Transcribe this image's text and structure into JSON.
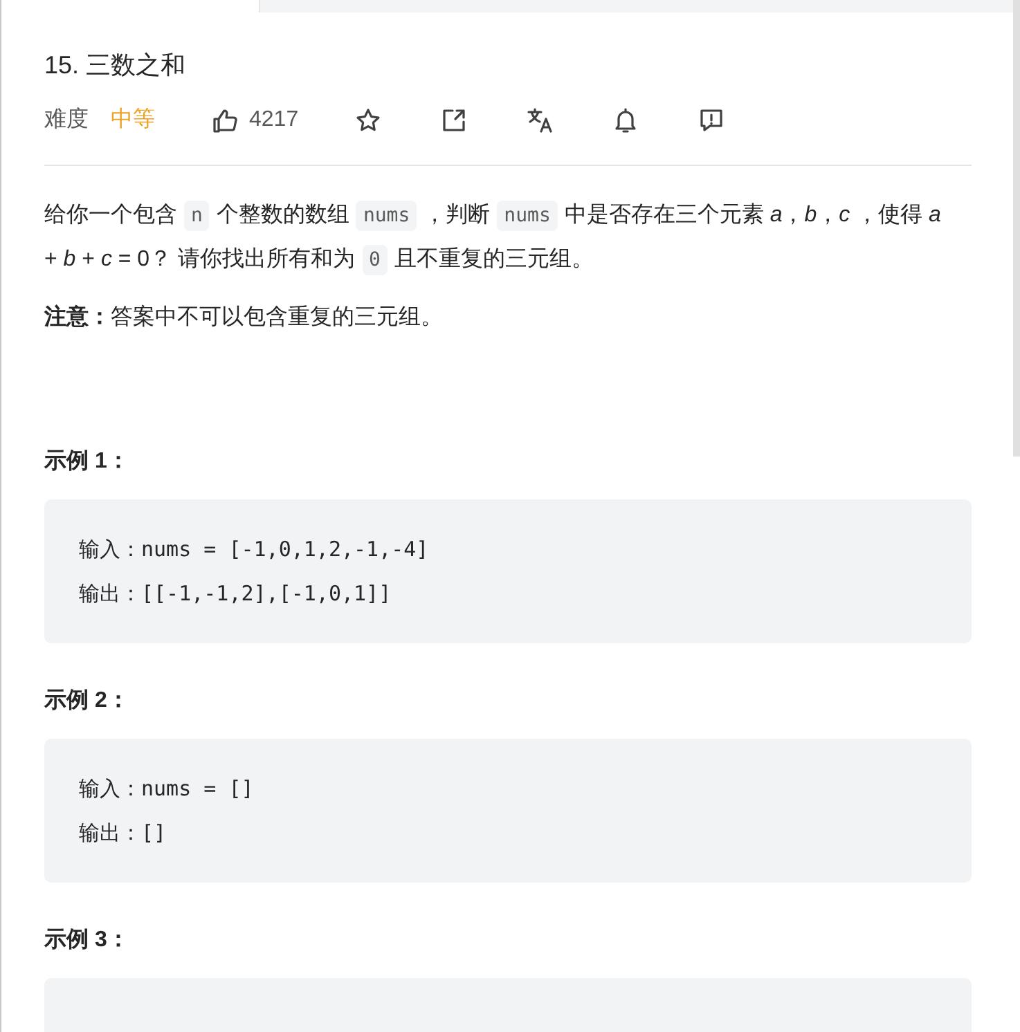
{
  "problem": {
    "title": "15. 三数之和",
    "difficulty_label": "难度",
    "difficulty": "中等",
    "likes": "4217"
  },
  "description": [
    {
      "kind": "text",
      "text": "给你一个包含"
    },
    {
      "kind": "code",
      "text": "n"
    },
    {
      "kind": "text",
      "text": "个整数的数组"
    },
    {
      "kind": "code",
      "text": "nums"
    },
    {
      "kind": "text",
      "text": "，判断"
    },
    {
      "kind": "code",
      "text": "nums"
    },
    {
      "kind": "text",
      "text": "中是否存在三个元素 *a*，*b*，*c* ，使得 *a* + *b* + *c* = 0？ 请你找出所有和为"
    },
    {
      "kind": "code",
      "text": "0"
    },
    {
      "kind": "text",
      "text": "且不重复的三元组。"
    }
  ],
  "note": "**注意：**答案中不可以包含重复的三元组。",
  "examples": [
    {
      "heading": "示例 1：",
      "lines": [
        "输入：nums = [-1,0,1,2,-1,-4]",
        "输出：[[-1,-1,2],[-1,0,1]]"
      ]
    },
    {
      "heading": "示例 2：",
      "lines": [
        "输入：nums = []",
        "输出：[]"
      ]
    },
    {
      "heading": "示例 3："
    }
  ]
}
